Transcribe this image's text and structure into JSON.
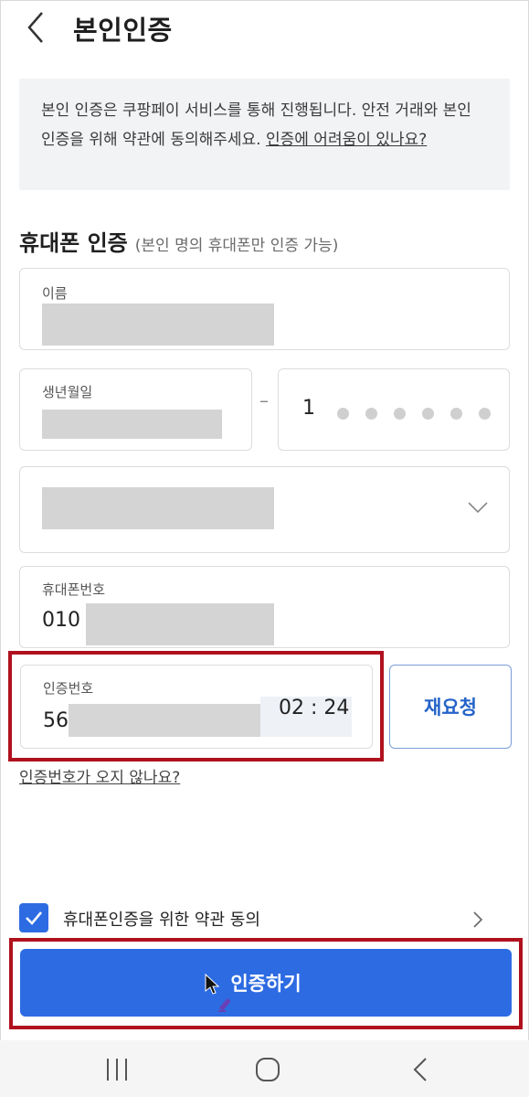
{
  "header": {
    "title": "본인인증"
  },
  "notice": {
    "text": "본인 인증은 쿠팡페이 서비스를 통해 진행됩니다. 안전 거래와 본인 인증을 위해 약관에 동의해주세요.",
    "link": "인증에 어려움이 있나요?"
  },
  "section": {
    "title": "휴대폰 인증",
    "subtitle": "(본인 명의 휴대폰만 인증 가능)"
  },
  "form": {
    "name_label": "이름",
    "birth_label": "생년월일",
    "rrn_first_digit": "1",
    "phone_label": "휴대폰번호",
    "phone_prefix": "010",
    "code_label": "인증번호",
    "code_value": "56",
    "timer": "02 : 24",
    "resend_label": "재요청",
    "no_code_link": "인증번호가 오지 않나요?"
  },
  "agreement": {
    "label": "휴대폰인증을 위한 약관 동의",
    "checked": true
  },
  "submit": {
    "label": "인증하기"
  },
  "colors": {
    "primary": "#2d6be2",
    "highlight": "#b0111e",
    "notice_bg": "#f2f3f5"
  }
}
